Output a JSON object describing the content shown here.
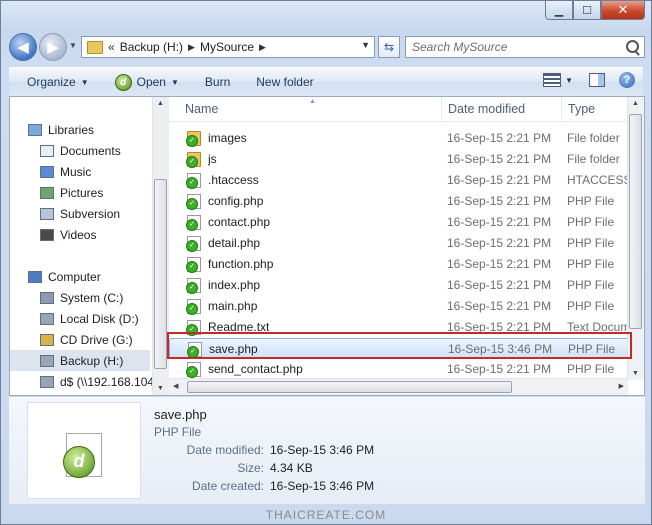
{
  "window": {
    "caption": {
      "minimize": "▁",
      "maximize": "☐",
      "close": "✕"
    }
  },
  "address_bar": {
    "overflow": "«",
    "crumbs": [
      "Backup (H:)",
      "MySource"
    ],
    "search_placeholder": "Search MySource"
  },
  "toolbar": {
    "organize": "Organize",
    "open": "Open",
    "burn": "Burn",
    "new_folder": "New folder"
  },
  "nav_pane": {
    "items": [
      {
        "label": "Libraries",
        "icon": "libraries-icon"
      },
      {
        "label": "Documents",
        "icon": "documents-icon"
      },
      {
        "label": "Music",
        "icon": "music-icon"
      },
      {
        "label": "Pictures",
        "icon": "pictures-icon"
      },
      {
        "label": "Subversion",
        "icon": "subversion-icon"
      },
      {
        "label": "Videos",
        "icon": "videos-icon"
      },
      {
        "label": "Computer",
        "icon": "computer-icon"
      },
      {
        "label": "System  (C:)",
        "icon": "system-drive-icon"
      },
      {
        "label": "Local Disk (D:)",
        "icon": "local-disk-icon"
      },
      {
        "label": "CD Drive (G:)",
        "icon": "cd-drive-icon"
      },
      {
        "label": "Backup (H:)",
        "icon": "backup-drive-icon",
        "selected": true
      },
      {
        "label": "d$ (\\\\192.168.104",
        "icon": "network-drive-icon"
      }
    ]
  },
  "file_list": {
    "columns": {
      "name": "Name",
      "date": "Date modified",
      "type": "Type"
    },
    "rows": [
      {
        "name": "images",
        "date": "16-Sep-15 2:21 PM",
        "type": "File folder",
        "kind": "folder"
      },
      {
        "name": "js",
        "date": "16-Sep-15 2:21 PM",
        "type": "File folder",
        "kind": "folder"
      },
      {
        "name": ".htaccess",
        "date": "16-Sep-15 2:21 PM",
        "type": "HTACCESS",
        "kind": "file"
      },
      {
        "name": "config.php",
        "date": "16-Sep-15 2:21 PM",
        "type": "PHP File",
        "kind": "file"
      },
      {
        "name": "contact.php",
        "date": "16-Sep-15 2:21 PM",
        "type": "PHP File",
        "kind": "file"
      },
      {
        "name": "detail.php",
        "date": "16-Sep-15 2:21 PM",
        "type": "PHP File",
        "kind": "file"
      },
      {
        "name": "function.php",
        "date": "16-Sep-15 2:21 PM",
        "type": "PHP File",
        "kind": "file"
      },
      {
        "name": "index.php",
        "date": "16-Sep-15 2:21 PM",
        "type": "PHP File",
        "kind": "file"
      },
      {
        "name": "main.php",
        "date": "16-Sep-15 2:21 PM",
        "type": "PHP File",
        "kind": "file"
      },
      {
        "name": "Readme.txt",
        "date": "16-Sep-15 2:21 PM",
        "type": "Text Docum",
        "kind": "file"
      },
      {
        "name": "save.php",
        "date": "16-Sep-15 3:46 PM",
        "type": "PHP File",
        "kind": "file",
        "selected": true
      },
      {
        "name": "send_contact.php",
        "date": "16-Sep-15 2:21 PM",
        "type": "PHP File",
        "kind": "file"
      }
    ]
  },
  "details": {
    "name": "save.php",
    "type": "PHP File",
    "modified_label": "Date modified:",
    "modified_value": "16-Sep-15 3:46 PM",
    "size_label": "Size:",
    "size_value": "4.34 KB",
    "created_label": "Date created:",
    "created_value": "16-Sep-15 3:46 PM"
  },
  "watermark": "THAICREATE.COM",
  "colors": {
    "highlight_border": "#c52a2a",
    "selection": "#cde2f9"
  }
}
